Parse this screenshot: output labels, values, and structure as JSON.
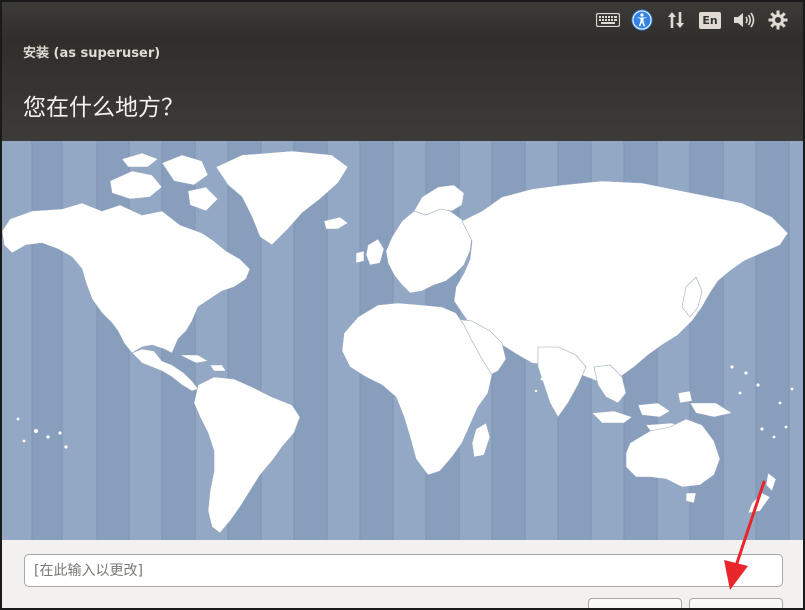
{
  "window": {
    "title": "安装 (as superuser)"
  },
  "page": {
    "title": "您在什么地方？"
  },
  "tray": {
    "icons": [
      "keyboard-icon",
      "accessibility-icon",
      "network-icon",
      "language-icon",
      "volume-icon",
      "gear-icon"
    ],
    "language_label": "En"
  },
  "map": {
    "ocean_color": "#92a8c5",
    "land_color": "#ffffff"
  },
  "timezone": {
    "placeholder": "[在此输入以更改]",
    "value": ""
  },
  "annotation": {
    "color": "#e8262b"
  }
}
